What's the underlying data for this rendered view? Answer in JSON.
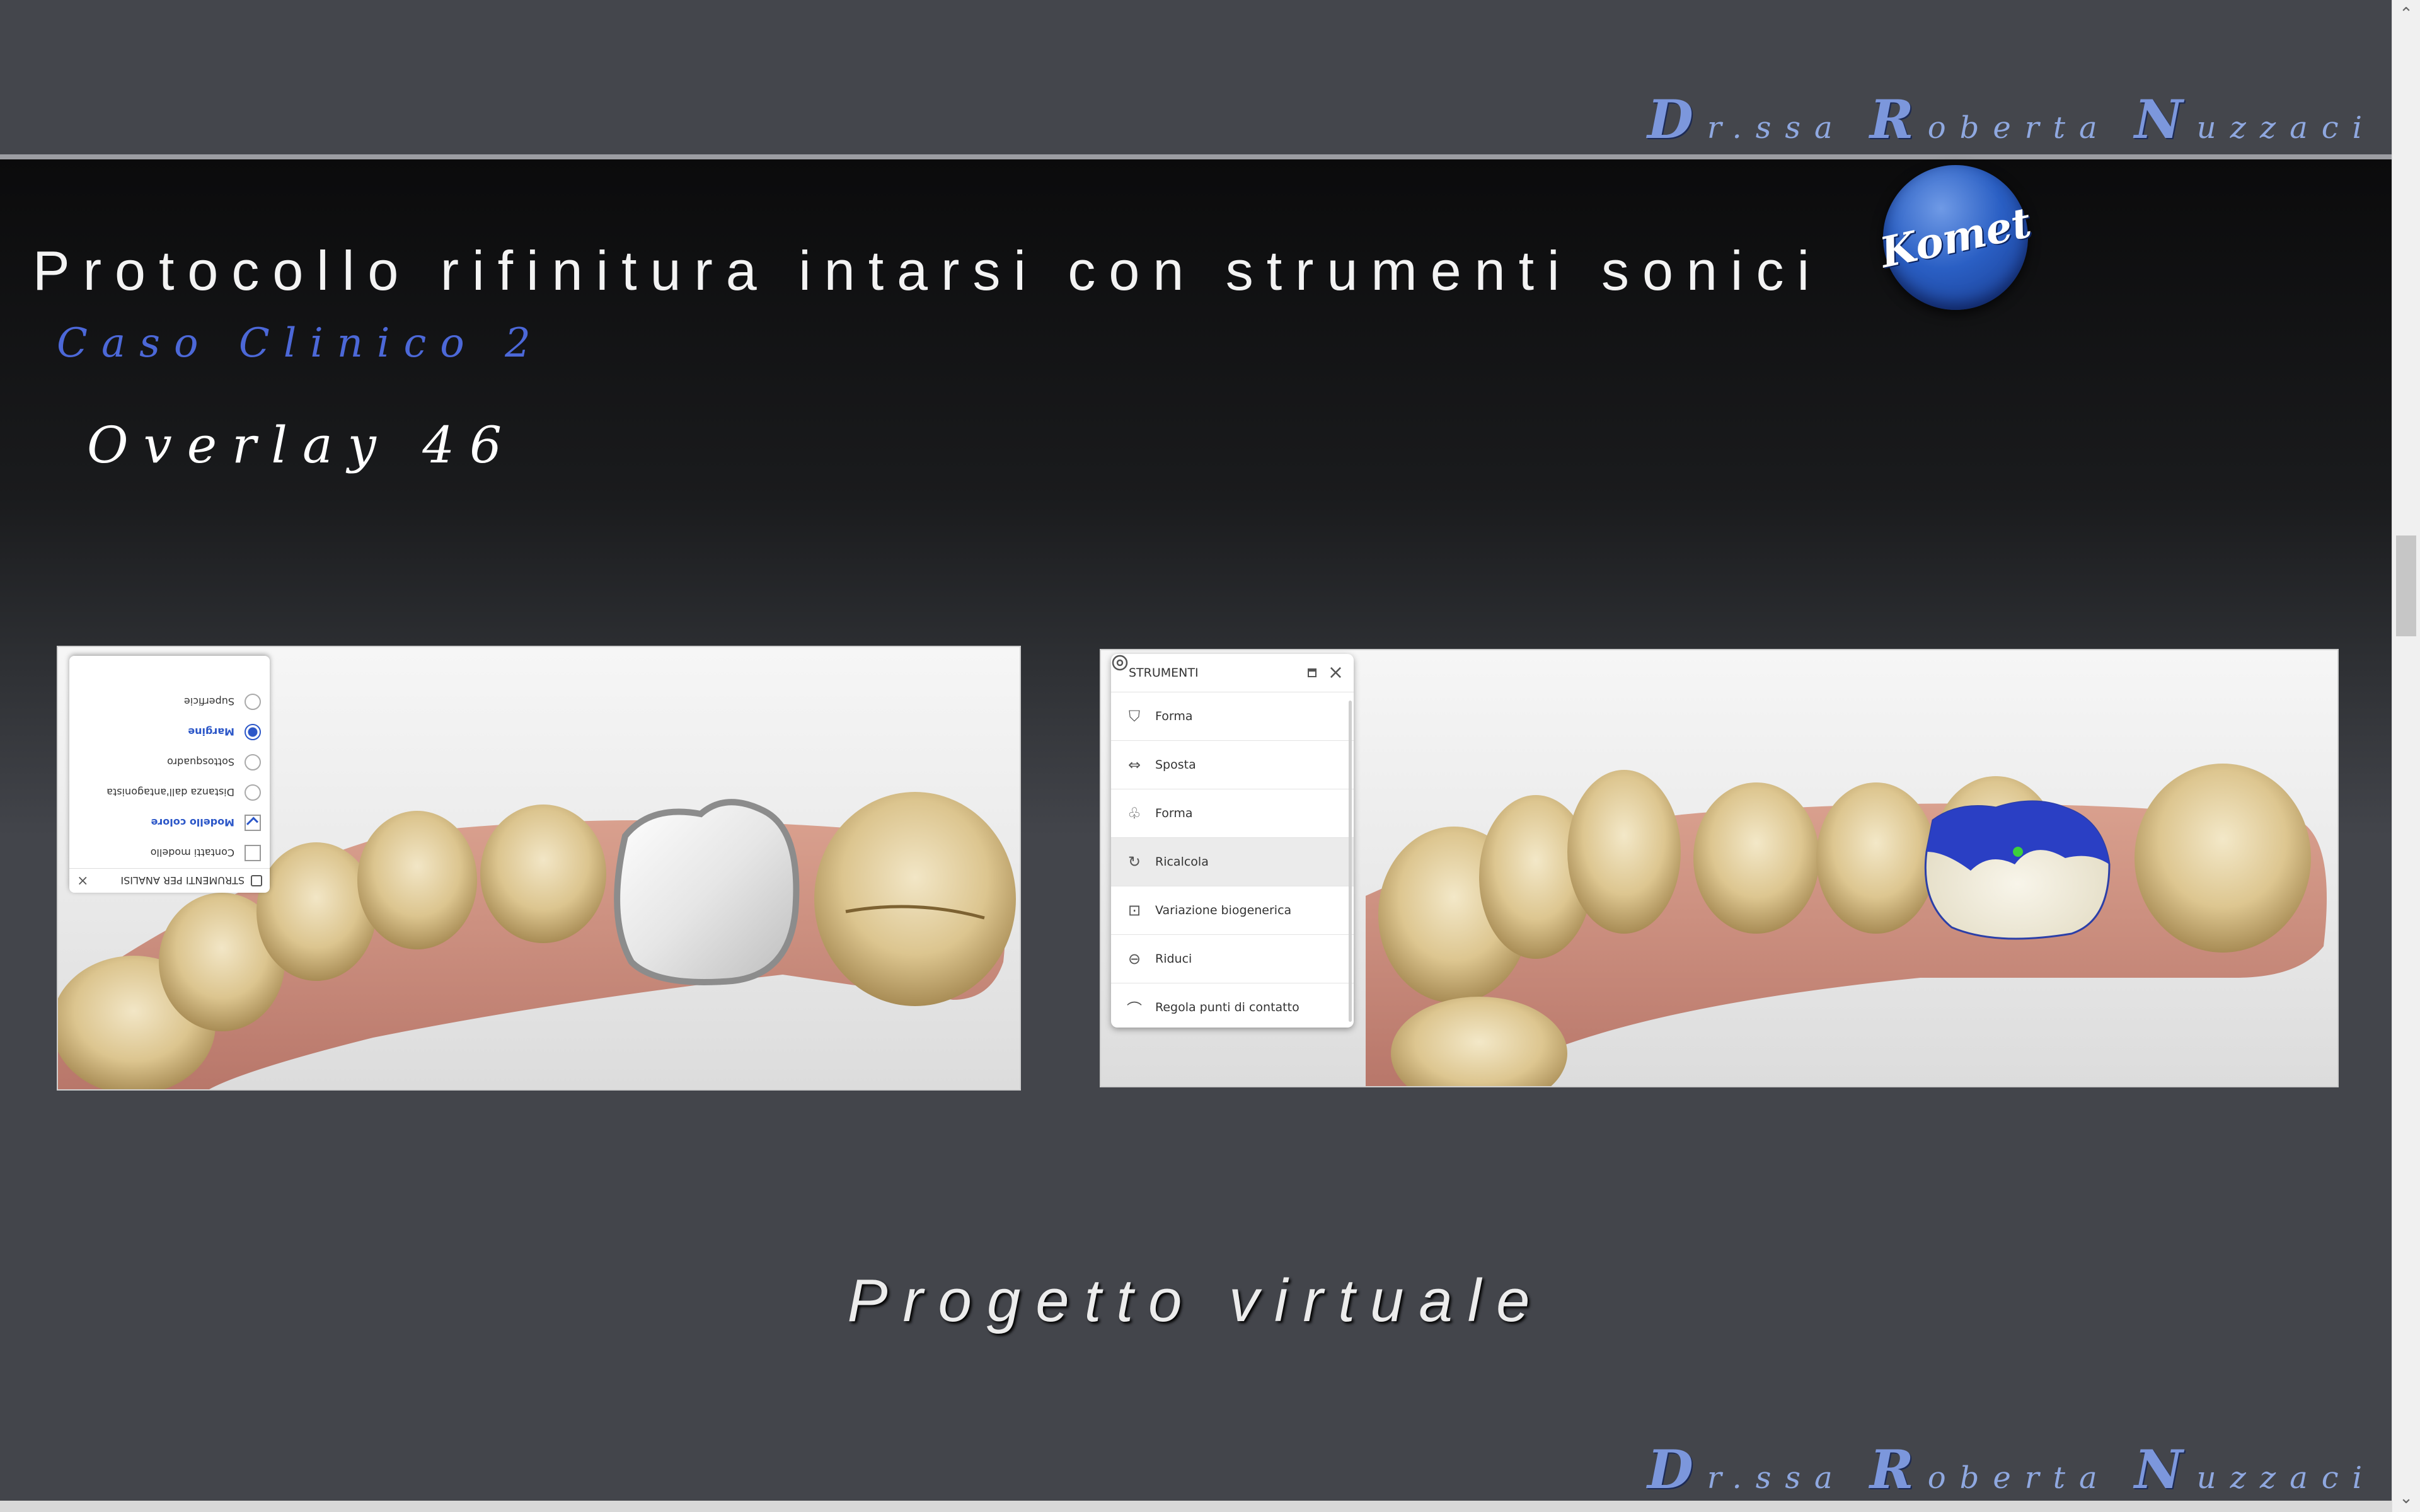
{
  "header": {
    "signature": [
      "Dr.ssa",
      "Roberta",
      "Nuzzaci"
    ]
  },
  "slide": {
    "title": "Protocollo rifinitura intarsi con strumenti sonici",
    "logo_text": "Komet",
    "subtitle": "Caso Clinico 2",
    "overlay_label": "Overlay 46",
    "caption": "Progetto virtuale"
  },
  "analysis_panel": {
    "title": "STRUMENTI PER ANALISI",
    "items": [
      {
        "label": "Contatti modello",
        "type": "checkbox",
        "checked": false
      },
      {
        "label": "Modello colore",
        "type": "checkbox",
        "checked": true
      },
      {
        "label": "Distanza dall'antagonista",
        "type": "radio",
        "selected": false
      },
      {
        "label": "Sottosquadro",
        "type": "radio",
        "selected": false
      },
      {
        "label": "Margine",
        "type": "radio",
        "selected": true
      },
      {
        "label": "Superficie",
        "type": "radio",
        "selected": false
      }
    ]
  },
  "tools_panel": {
    "title": "STRUMENTI",
    "items": [
      {
        "label": "Forma",
        "icon": "tooth-cursor-icon"
      },
      {
        "label": "Sposta",
        "icon": "move-tooth-icon"
      },
      {
        "label": "Forma",
        "icon": "tooth-shape-icon"
      },
      {
        "label": "Ricalcola",
        "icon": "recalculate-icon",
        "active": true
      },
      {
        "label": "Variazione biogenerica",
        "icon": "biogeneric-icon"
      },
      {
        "label": "Riduci",
        "icon": "reduce-icon"
      },
      {
        "label": "Regola punti di contatto",
        "icon": "contact-points-icon"
      }
    ]
  },
  "footer": {
    "signature": [
      "Dr.ssa",
      "Roberta",
      "Nuzzaci"
    ]
  },
  "colors": {
    "accent": "#4c68d8",
    "signature": "#8fa8e0",
    "background": "#43454b"
  }
}
